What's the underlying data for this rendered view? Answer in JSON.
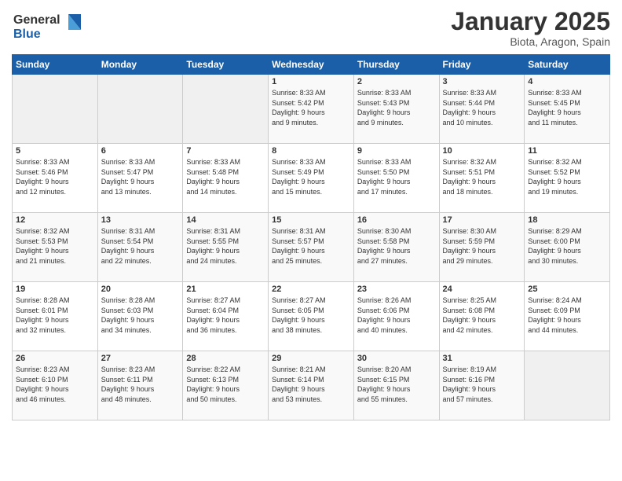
{
  "logo": {
    "line1": "General",
    "line2": "Blue"
  },
  "title": "January 2025",
  "subtitle": "Biota, Aragon, Spain",
  "weekdays": [
    "Sunday",
    "Monday",
    "Tuesday",
    "Wednesday",
    "Thursday",
    "Friday",
    "Saturday"
  ],
  "weeks": [
    [
      {
        "day": "",
        "info": ""
      },
      {
        "day": "",
        "info": ""
      },
      {
        "day": "",
        "info": ""
      },
      {
        "day": "1",
        "info": "Sunrise: 8:33 AM\nSunset: 5:42 PM\nDaylight: 9 hours\nand 9 minutes."
      },
      {
        "day": "2",
        "info": "Sunrise: 8:33 AM\nSunset: 5:43 PM\nDaylight: 9 hours\nand 9 minutes."
      },
      {
        "day": "3",
        "info": "Sunrise: 8:33 AM\nSunset: 5:44 PM\nDaylight: 9 hours\nand 10 minutes."
      },
      {
        "day": "4",
        "info": "Sunrise: 8:33 AM\nSunset: 5:45 PM\nDaylight: 9 hours\nand 11 minutes."
      }
    ],
    [
      {
        "day": "5",
        "info": "Sunrise: 8:33 AM\nSunset: 5:46 PM\nDaylight: 9 hours\nand 12 minutes."
      },
      {
        "day": "6",
        "info": "Sunrise: 8:33 AM\nSunset: 5:47 PM\nDaylight: 9 hours\nand 13 minutes."
      },
      {
        "day": "7",
        "info": "Sunrise: 8:33 AM\nSunset: 5:48 PM\nDaylight: 9 hours\nand 14 minutes."
      },
      {
        "day": "8",
        "info": "Sunrise: 8:33 AM\nSunset: 5:49 PM\nDaylight: 9 hours\nand 15 minutes."
      },
      {
        "day": "9",
        "info": "Sunrise: 8:33 AM\nSunset: 5:50 PM\nDaylight: 9 hours\nand 17 minutes."
      },
      {
        "day": "10",
        "info": "Sunrise: 8:32 AM\nSunset: 5:51 PM\nDaylight: 9 hours\nand 18 minutes."
      },
      {
        "day": "11",
        "info": "Sunrise: 8:32 AM\nSunset: 5:52 PM\nDaylight: 9 hours\nand 19 minutes."
      }
    ],
    [
      {
        "day": "12",
        "info": "Sunrise: 8:32 AM\nSunset: 5:53 PM\nDaylight: 9 hours\nand 21 minutes."
      },
      {
        "day": "13",
        "info": "Sunrise: 8:31 AM\nSunset: 5:54 PM\nDaylight: 9 hours\nand 22 minutes."
      },
      {
        "day": "14",
        "info": "Sunrise: 8:31 AM\nSunset: 5:55 PM\nDaylight: 9 hours\nand 24 minutes."
      },
      {
        "day": "15",
        "info": "Sunrise: 8:31 AM\nSunset: 5:57 PM\nDaylight: 9 hours\nand 25 minutes."
      },
      {
        "day": "16",
        "info": "Sunrise: 8:30 AM\nSunset: 5:58 PM\nDaylight: 9 hours\nand 27 minutes."
      },
      {
        "day": "17",
        "info": "Sunrise: 8:30 AM\nSunset: 5:59 PM\nDaylight: 9 hours\nand 29 minutes."
      },
      {
        "day": "18",
        "info": "Sunrise: 8:29 AM\nSunset: 6:00 PM\nDaylight: 9 hours\nand 30 minutes."
      }
    ],
    [
      {
        "day": "19",
        "info": "Sunrise: 8:28 AM\nSunset: 6:01 PM\nDaylight: 9 hours\nand 32 minutes."
      },
      {
        "day": "20",
        "info": "Sunrise: 8:28 AM\nSunset: 6:03 PM\nDaylight: 9 hours\nand 34 minutes."
      },
      {
        "day": "21",
        "info": "Sunrise: 8:27 AM\nSunset: 6:04 PM\nDaylight: 9 hours\nand 36 minutes."
      },
      {
        "day": "22",
        "info": "Sunrise: 8:27 AM\nSunset: 6:05 PM\nDaylight: 9 hours\nand 38 minutes."
      },
      {
        "day": "23",
        "info": "Sunrise: 8:26 AM\nSunset: 6:06 PM\nDaylight: 9 hours\nand 40 minutes."
      },
      {
        "day": "24",
        "info": "Sunrise: 8:25 AM\nSunset: 6:08 PM\nDaylight: 9 hours\nand 42 minutes."
      },
      {
        "day": "25",
        "info": "Sunrise: 8:24 AM\nSunset: 6:09 PM\nDaylight: 9 hours\nand 44 minutes."
      }
    ],
    [
      {
        "day": "26",
        "info": "Sunrise: 8:23 AM\nSunset: 6:10 PM\nDaylight: 9 hours\nand 46 minutes."
      },
      {
        "day": "27",
        "info": "Sunrise: 8:23 AM\nSunset: 6:11 PM\nDaylight: 9 hours\nand 48 minutes."
      },
      {
        "day": "28",
        "info": "Sunrise: 8:22 AM\nSunset: 6:13 PM\nDaylight: 9 hours\nand 50 minutes."
      },
      {
        "day": "29",
        "info": "Sunrise: 8:21 AM\nSunset: 6:14 PM\nDaylight: 9 hours\nand 53 minutes."
      },
      {
        "day": "30",
        "info": "Sunrise: 8:20 AM\nSunset: 6:15 PM\nDaylight: 9 hours\nand 55 minutes."
      },
      {
        "day": "31",
        "info": "Sunrise: 8:19 AM\nSunset: 6:16 PM\nDaylight: 9 hours\nand 57 minutes."
      },
      {
        "day": "",
        "info": ""
      }
    ]
  ]
}
